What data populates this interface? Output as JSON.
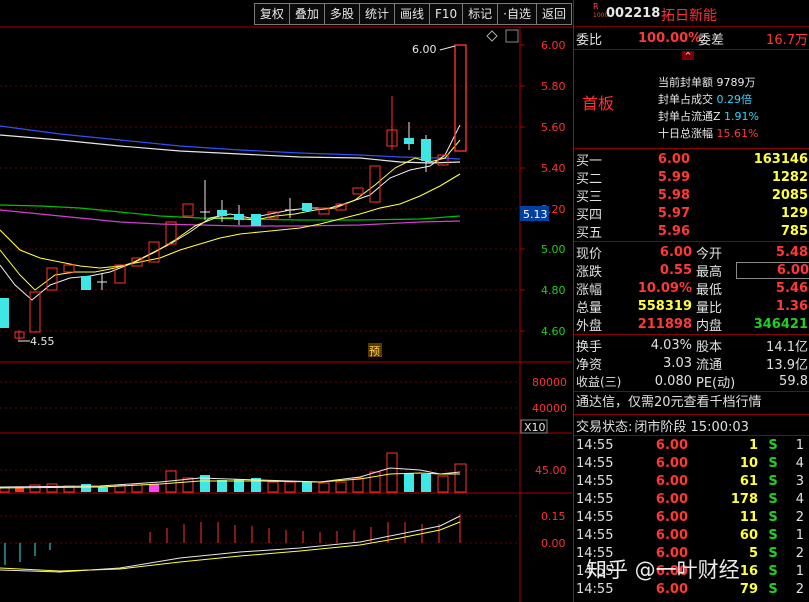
{
  "toolbar": [
    "复权",
    "叠加",
    "多股",
    "统计",
    "画线",
    "F10",
    "标记",
    "·自选",
    "返回"
  ],
  "header": {
    "badge_top": "R",
    "badge_bottom": "1000",
    "code": "002218",
    "name": "拓日新能"
  },
  "quote_top": {
    "weibi_label": "委比",
    "weibi": "100.00%",
    "weicha_label": "委差",
    "weicha": "16.7万"
  },
  "seal": {
    "board": "首板",
    "lines": [
      {
        "label": "当前封单额",
        "value": "9789万"
      },
      {
        "label": "封单占成交",
        "value": "0.29倍"
      },
      {
        "label": "封单占流通Z",
        "value": "1.91%"
      },
      {
        "label": "十日总涨幅",
        "value": "15.61%"
      }
    ]
  },
  "bids": [
    {
      "label": "买一",
      "price": "6.00",
      "vol": "163146"
    },
    {
      "label": "买二",
      "price": "5.99",
      "vol": "1282"
    },
    {
      "label": "买三",
      "price": "5.98",
      "vol": "2085"
    },
    {
      "label": "买四",
      "price": "5.97",
      "vol": "129"
    },
    {
      "label": "买五",
      "price": "5.96",
      "vol": "785"
    }
  ],
  "stats": [
    {
      "l1": "现价",
      "v1": "6.00",
      "l2": "今开",
      "v2": "5.48"
    },
    {
      "l1": "涨跌",
      "v1": "0.55",
      "l2": "最高",
      "v2": "6.00"
    },
    {
      "l1": "涨幅",
      "v1": "10.09%",
      "l2": "最低",
      "v2": "5.46"
    },
    {
      "l1": "总量",
      "v1": "558319",
      "l2": "量比",
      "v2": "1.36"
    },
    {
      "l1": "外盘",
      "v1": "211898",
      "l2": "内盘",
      "v2": "346421"
    }
  ],
  "finance": [
    {
      "l1": "换手",
      "v1": "4.03%",
      "l2": "股本",
      "v2": "14.1亿"
    },
    {
      "l1": "净资",
      "v1": "3.03",
      "l2": "流通",
      "v2": "13.9亿"
    },
    {
      "l1": "收益(三)",
      "v1": "0.080",
      "l2": "PE(动)",
      "v2": "59.8"
    }
  ],
  "notice": "通达信，仅需20元查看千档行情",
  "status": {
    "label": "交易状态:",
    "value": "闭市阶段 15:00:03"
  },
  "trades": [
    {
      "time": "14:55",
      "price": "6.00",
      "vol": "1",
      "bs": "S",
      "n": "1"
    },
    {
      "time": "14:55",
      "price": "6.00",
      "vol": "10",
      "bs": "S",
      "n": "4"
    },
    {
      "time": "14:55",
      "price": "6.00",
      "vol": "61",
      "bs": "S",
      "n": "3"
    },
    {
      "time": "14:55",
      "price": "6.00",
      "vol": "178",
      "bs": "S",
      "n": "4"
    },
    {
      "time": "14:55",
      "price": "6.00",
      "vol": "11",
      "bs": "S",
      "n": "2"
    },
    {
      "time": "14:55",
      "price": "6.00",
      "vol": "60",
      "bs": "S",
      "n": "1"
    },
    {
      "time": "14:55",
      "price": "6.00",
      "vol": "5",
      "bs": "S",
      "n": "2"
    },
    {
      "time": "14:55",
      "price": "6.00",
      "vol": "16",
      "bs": "S",
      "n": "1"
    },
    {
      "time": "14:55",
      "price": "6.00",
      "vol": "79",
      "bs": "S",
      "n": "2"
    }
  ],
  "chart": {
    "price_ticks": [
      "6.00",
      "5.80",
      "5.60",
      "5.40",
      "5.20",
      "5.00",
      "4.80",
      "4.60"
    ],
    "current_price": "5.13",
    "high_label": "6.00",
    "low_label": "4.55",
    "yu_label": "预",
    "vol_ticks": [
      "80000",
      "40000"
    ],
    "vol_unit": "X10",
    "vol_ind_tick": "45.00",
    "macd_ticks": [
      "0.15",
      "0.00"
    ]
  },
  "watermark": "知乎 @一叶财经",
  "colors": {
    "up": "#ff3030",
    "down": "#3fe6e6",
    "ma1": "#ffffff",
    "ma2": "#ffff40",
    "ma3": "#ff40ff",
    "ma4": "#00c000",
    "ma5": "#3060ff"
  }
}
